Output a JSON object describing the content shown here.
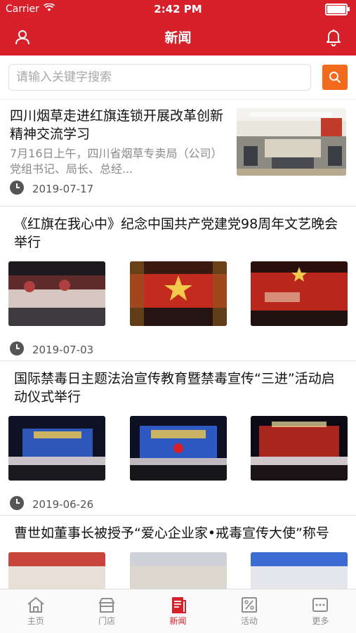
{
  "status_bar": {
    "carrier": "Carrier",
    "time": "2:42 PM"
  },
  "header": {
    "title": "新闻"
  },
  "search": {
    "placeholder": "请输入关键字搜索"
  },
  "colors": {
    "brand_red": "#d7202a",
    "search_orange": "#f26b1d"
  },
  "news": [
    {
      "title": "四川烟草走进红旗连锁开展改革创新精神交流学习",
      "summary": "7月16日上午，四川省烟草专卖局（公司）党组书记、局长、总经...",
      "date": "2019-07-17"
    },
    {
      "title": "《红旗在我心中》纪念中国共产党建党98周年文艺晚会举行",
      "date": "2019-07-03"
    },
    {
      "title": "国际禁毒日主题法治宣传教育暨禁毒宣传“三进”活动启动仪式举行",
      "date": "2019-06-26"
    },
    {
      "title": "曹世如董事长被授予“爱心企业家•戒毒宣传大使”称号"
    }
  ],
  "tabs": [
    {
      "label": "主页",
      "icon": "home-icon"
    },
    {
      "label": "门店",
      "icon": "store-icon"
    },
    {
      "label": "新闻",
      "icon": "news-icon",
      "active": true
    },
    {
      "label": "活动",
      "icon": "discount-icon"
    },
    {
      "label": "更多",
      "icon": "more-icon"
    }
  ]
}
